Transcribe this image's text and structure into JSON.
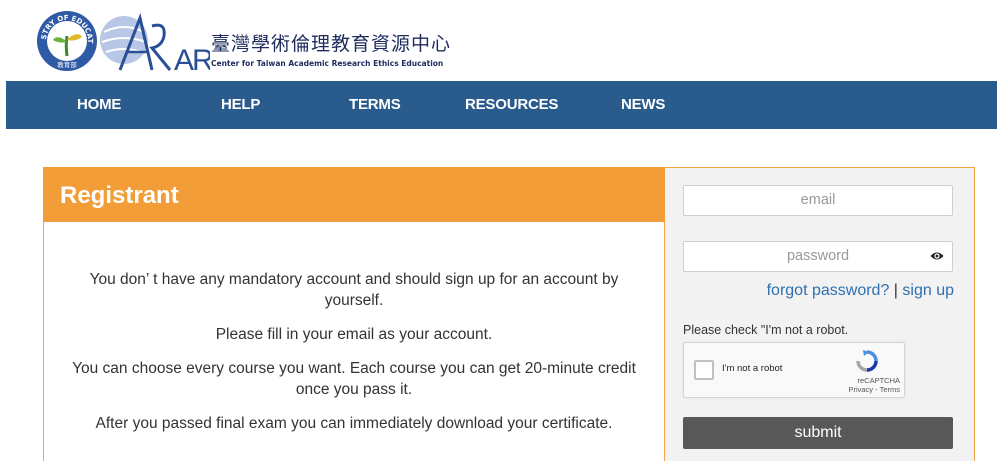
{
  "header": {
    "moe_logo_text": "MINISTRY OF EDUCATION",
    "moe_logo_sub": "教育部",
    "aree_logo_text": "AREE",
    "title_zh": "臺灣學術倫理教育資源中心",
    "title_en": "Center for Taiwan Academic Research Ethics Education"
  },
  "nav": {
    "items": [
      {
        "label": "HOME"
      },
      {
        "label": "HELP"
      },
      {
        "label": "TERMS"
      },
      {
        "label": "RESOURCES"
      },
      {
        "label": "NEWS"
      }
    ]
  },
  "registrant": {
    "title": "Registrant",
    "paragraphs": [
      "You don’ t have any mandatory account and should sign up for an account by yourself.",
      "Please fill in your email as your account.",
      "You can choose every course you want. Each course you can get 20-minute credit once you pass it.",
      "After you passed final exam you can immediately download your certificate."
    ]
  },
  "login": {
    "email_placeholder": "email",
    "password_placeholder": "password",
    "forgot_password": "forgot password?",
    "separator": "|",
    "sign_up": "sign up",
    "robot_note": "Please check \"I'm not a robot.",
    "captcha_label": "I'm not a robot",
    "captcha_brand": "reCAPTCHA",
    "captcha_links": "Privacy - Terms",
    "submit": "submit"
  },
  "colors": {
    "nav_bg": "#2a5b8d",
    "registrant_header": "#f29d38",
    "border_accent": "#f0a748",
    "link": "#2f6fb0",
    "submit_bg": "#585858"
  },
  "icons": {
    "eye": "eye-icon",
    "captcha": "recaptcha-icon"
  }
}
